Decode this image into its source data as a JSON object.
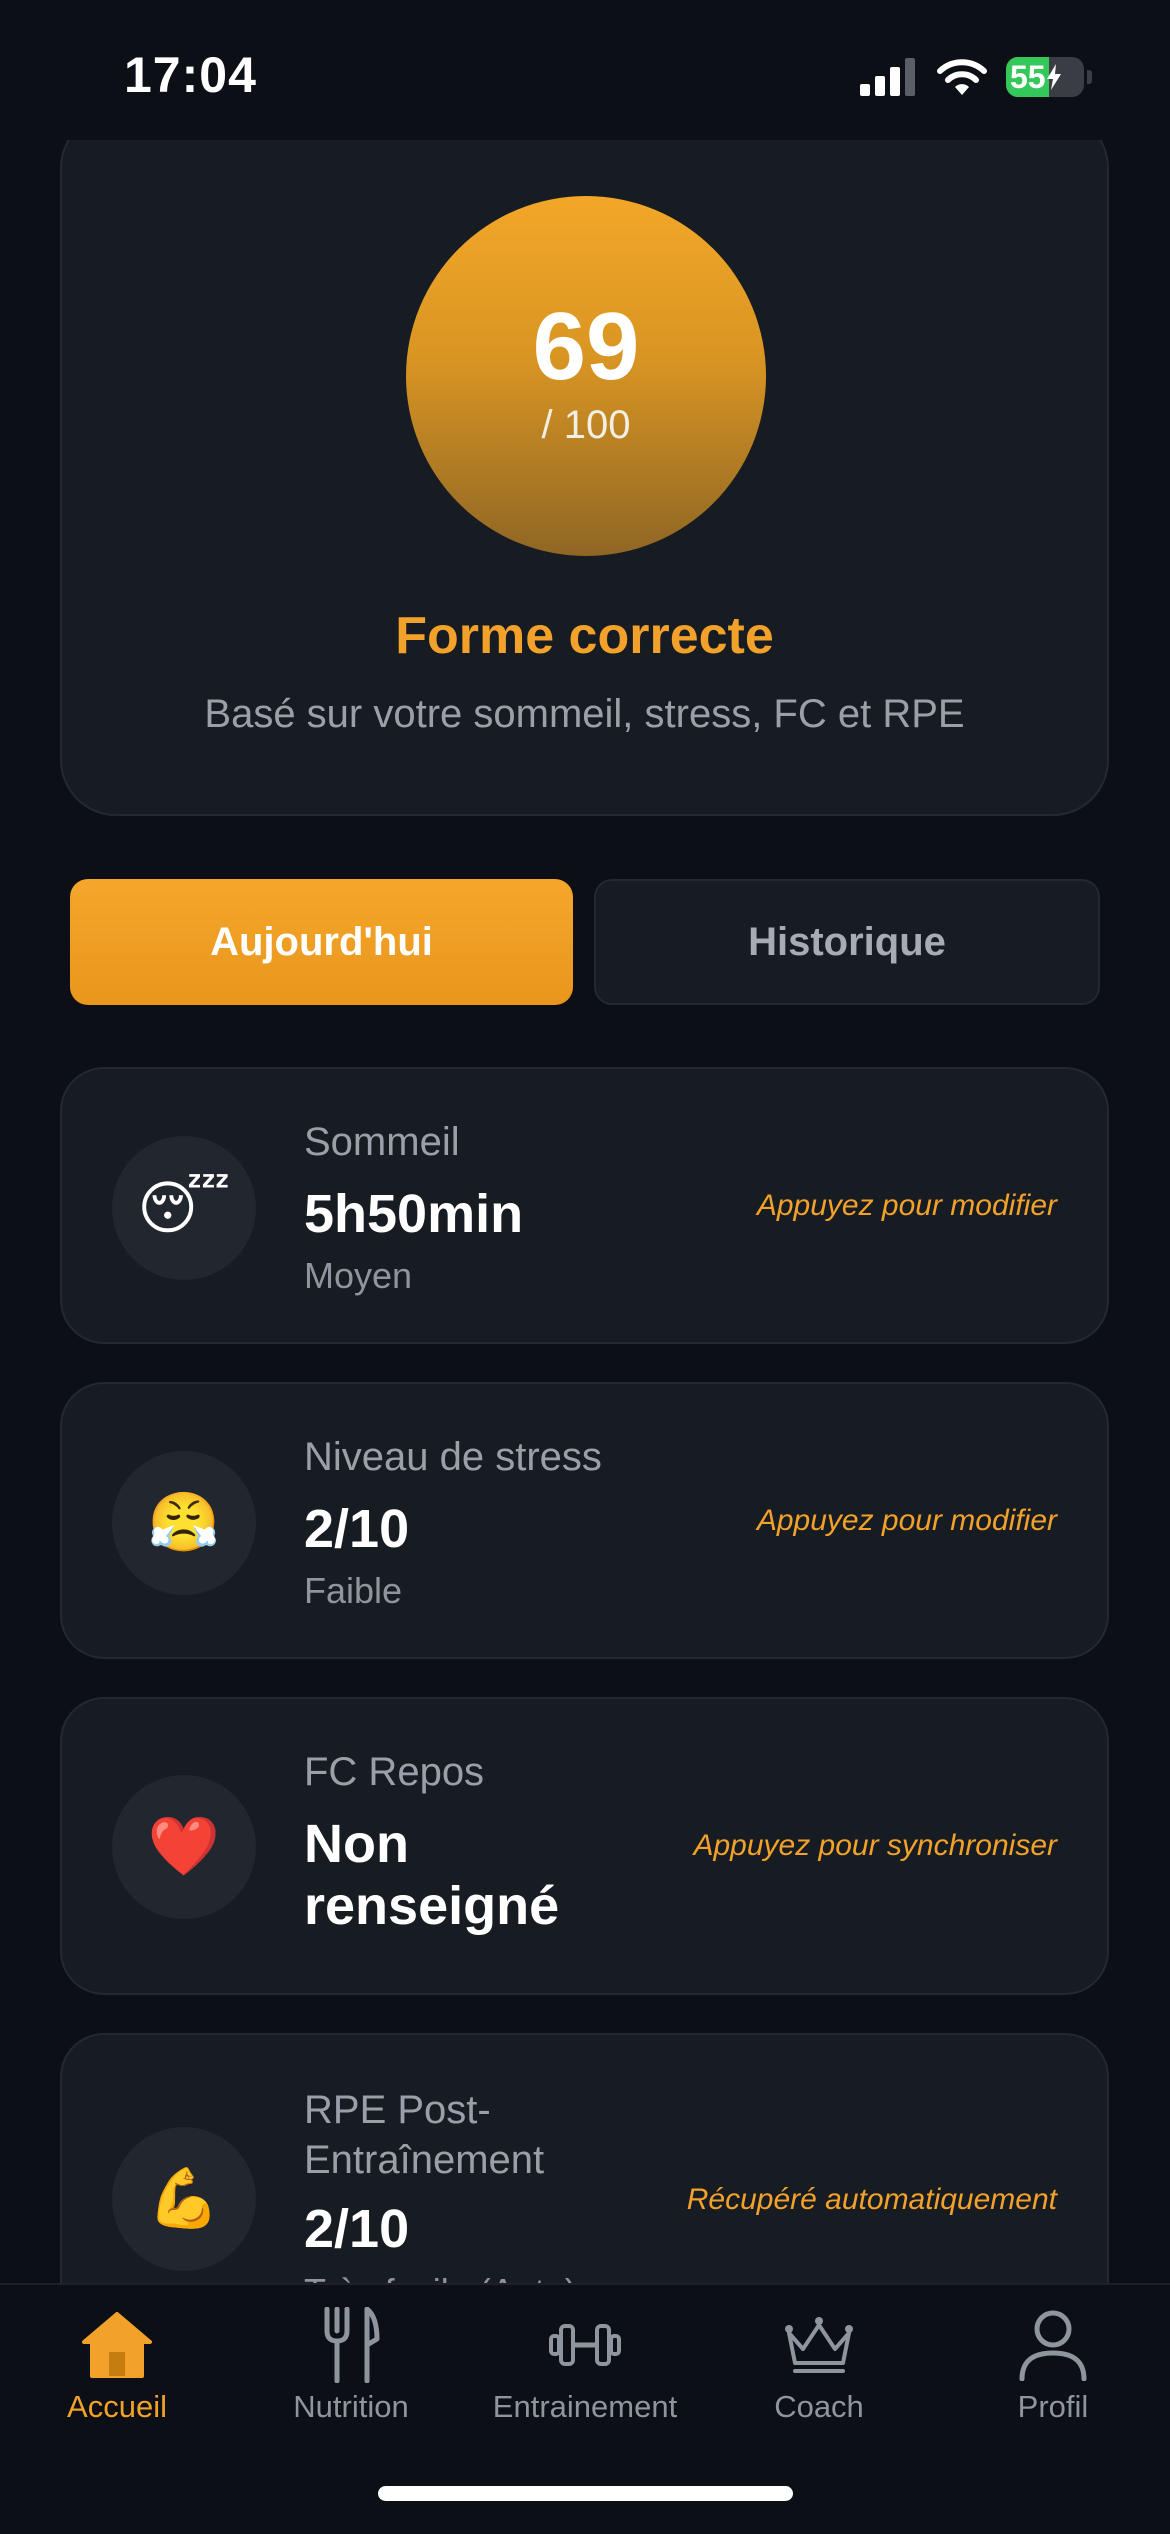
{
  "status_bar": {
    "time": "17:04",
    "battery": "55",
    "battery_level": 0.55
  },
  "score_card": {
    "score": "69",
    "max": "/ 100",
    "label": "Forme correcte",
    "description": "Basé sur votre sommeil, stress, FC et RPE"
  },
  "tabs": {
    "today": "Aujourd'hui",
    "history": "Historique"
  },
  "metrics": [
    {
      "title": "Sommeil",
      "value": "5h50min",
      "sub": "Moyen",
      "action": "Appuyez pour modifier",
      "icon": "sleeping-face-icon",
      "emoji": "😴"
    },
    {
      "title": "Niveau de stress",
      "value": "2/10",
      "sub": "Faible",
      "action": "Appuyez pour modifier",
      "icon": "steam-face-icon",
      "emoji": "😤"
    },
    {
      "title": "FC Repos",
      "value_line1": "Non",
      "value_line2": "renseigné",
      "action": "Appuyez pour synchroniser",
      "icon": "heart-icon",
      "emoji": "❤️"
    },
    {
      "title_line1": "RPE Post-",
      "title_line2": "Entraînement",
      "value": "2/10",
      "sub": "Très facile (Auto)",
      "action": "Récupéré automatiquement",
      "icon": "flexed-biceps-icon",
      "emoji": "💪"
    }
  ],
  "nav": {
    "home": "Accueil",
    "nutrition": "Nutrition",
    "training": "Entrainement",
    "coach": "Coach",
    "profile": "Profil"
  },
  "colors": {
    "accent": "#f2a12a",
    "background": "#0c0f15",
    "card": "#171b22"
  }
}
